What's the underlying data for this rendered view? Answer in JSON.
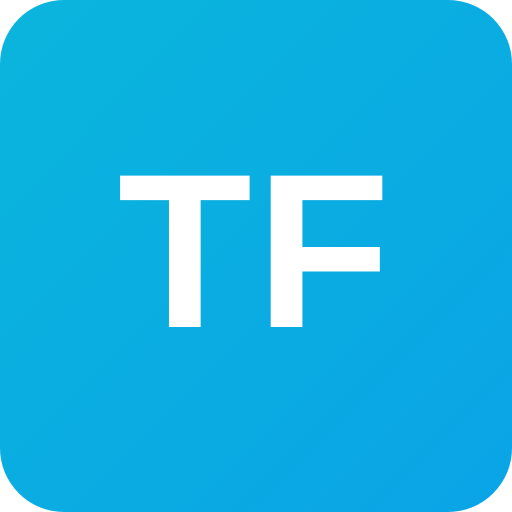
{
  "icon": {
    "monogram": "TF",
    "colors": {
      "gradient_start": "#0ab5dc",
      "gradient_end": "#0aa4e6",
      "text": "#ffffff",
      "page_background": "#ffffff"
    }
  }
}
